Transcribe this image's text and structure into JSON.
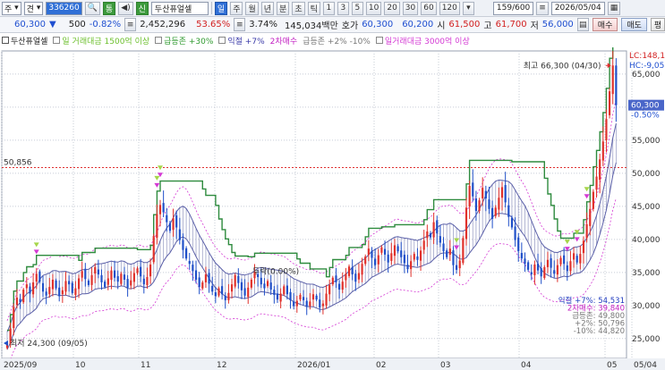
{
  "toolbar": {
    "mode_label": "주",
    "period_label": "견",
    "stock_code": "336260",
    "tag_label": "통",
    "sin_label": "신",
    "stock_name": "두산퓨얼셀",
    "period_selected": "일",
    "periods": [
      "주",
      "월",
      "년",
      "분",
      "초",
      "틱"
    ],
    "intervals": [
      "1",
      "3",
      "5",
      "10",
      "20",
      "30",
      "60",
      "120"
    ],
    "page_counter": "159/600",
    "date": "2026/05/04"
  },
  "quote": {
    "price": "60,300",
    "change_arrow": "▼",
    "change": "500",
    "change_pct": "-0.82%",
    "volume": "2,452,296",
    "ratio": "53.65%",
    "turnover": "3.74%",
    "amount": "145,034백만",
    "ask_label": "호가",
    "ask1": "60,300",
    "ask2": "60,200",
    "open_label": "시",
    "open": "61,500",
    "high_label": "고",
    "high": "61,700",
    "low_label": "저",
    "low": "56,000",
    "buy_label": "매수",
    "sell_label": "매도",
    "eval_label": "평"
  },
  "legend": {
    "stock_name": "두산퓨얼셀",
    "items": [
      {
        "label": "일 거래대금 1500억 이상",
        "color": "#6bbf2b"
      },
      {
        "label": "급등존 +30%",
        "color": "#2f9a2f"
      },
      {
        "label": "익절 +7%",
        "color": "#3a3aa8"
      },
      {
        "label": "2차매수",
        "color": "#c21fc2"
      },
      {
        "label": "급등존 +2% -10%",
        "color": "#777777"
      },
      {
        "label": "일거래대금 3000억 이상",
        "color": "#d43ad4"
      }
    ]
  },
  "chart_labels": {
    "left_marker": "50,856",
    "high_annotation": "최고 66,300 (04/30)",
    "low_annotation": "최저 24,300 (09/05)",
    "mid_annotation": "두락(0.00%)",
    "corner_lc": "LC:148,1",
    "corner_hc": "HC:-9,05",
    "current_price_tag": "60,300",
    "current_pct": "-0.50%",
    "info_rows": [
      {
        "label": "익절 +7%:",
        "value": "54,531",
        "color": "#1f3bbf"
      },
      {
        "label": "2차매수:",
        "value": "39,840",
        "color": "#c21fc2"
      },
      {
        "label": "급등존:",
        "value": "49,800",
        "color": "#777777"
      },
      {
        "label": "+2%:",
        "value": "50,796",
        "color": "#777777"
      },
      {
        "label": "-10%:",
        "value": "44,820",
        "color": "#777777"
      }
    ]
  },
  "colors": {
    "up": "#e0312b",
    "down": "#1f4fc8",
    "green_line": "#2e8b3e",
    "band": "#5a5fa8",
    "magenta": "#d43ad4",
    "grid": "#c7ccd6",
    "ref_line": "#e03030"
  },
  "chart_data": {
    "type": "candlestick",
    "y_ticks": [
      25000,
      30000,
      35000,
      40000,
      45000,
      50000,
      55000,
      60000,
      65000
    ],
    "y_tick_labels": [
      "25,000",
      "30,000",
      "35,000",
      "40,000",
      "45,000",
      "50,000",
      "55,000",
      "60,000",
      "65,000"
    ],
    "ylim": [
      22000,
      68500
    ],
    "x_tick_labels": [
      "2025/09",
      "10",
      "11",
      "12",
      "2026/01",
      "02",
      "03",
      "04",
      "05",
      "05/04"
    ],
    "reference_level": 50856,
    "highest": {
      "value": 66300,
      "date": "04/30"
    },
    "lowest": {
      "value": 24300,
      "date": "09/05"
    },
    "closes": [
      24300,
      26500,
      29800,
      31200,
      30500,
      32400,
      33200,
      31800,
      33500,
      34800,
      33600,
      32100,
      31500,
      32800,
      33900,
      32600,
      31400,
      32300,
      33700,
      33200,
      31900,
      32600,
      34100,
      35200,
      34000,
      33100,
      34600,
      35800,
      34700,
      33500,
      32800,
      34100,
      35300,
      34200,
      33600,
      34800,
      33900,
      32700,
      33800,
      34900,
      35600,
      34400,
      33200,
      34300,
      36200,
      40500,
      43800,
      45200,
      44100,
      42600,
      41300,
      43200,
      41800,
      39900,
      38400,
      37100,
      36300,
      35200,
      33900,
      32800,
      33500,
      34700,
      33300,
      32100,
      31400,
      32600,
      31700,
      30800,
      31900,
      33200,
      34600,
      33400,
      32300,
      31500,
      32700,
      33900,
      35100,
      34300,
      33200,
      32600,
      33700,
      32400,
      31600,
      30900,
      31800,
      32900,
      31700,
      30800,
      29900,
      30700,
      31600,
      30800,
      29800,
      30600,
      31700,
      30900,
      29700,
      30300,
      31800,
      33100,
      34200,
      33500,
      32400,
      33600,
      34800,
      35900,
      34700,
      33600,
      34900,
      36300,
      37400,
      38600,
      37200,
      36100,
      37600,
      38800,
      37700,
      36500,
      37900,
      39100,
      38200,
      37300,
      36400,
      35500,
      36700,
      37800,
      36900,
      38300,
      39800,
      41200,
      40300,
      42600,
      40900,
      39500,
      38200,
      37300,
      38600,
      36100,
      35400,
      36800,
      40200,
      44800,
      48100,
      46500,
      44300,
      45900,
      47800,
      46200,
      44600,
      43100,
      44800,
      46300,
      47900,
      45600,
      43400,
      41800,
      39900,
      38200,
      37100,
      36300,
      35400,
      34700,
      36200,
      35300,
      34400,
      35800,
      36900,
      35700,
      34800,
      36100,
      37200,
      36300,
      35200,
      36700,
      37900,
      36500,
      37800,
      39800,
      42300,
      44600,
      47200,
      49500,
      52100,
      54800,
      58200,
      62400,
      66300,
      60300
    ],
    "series": [
      {
        "name": "급등존 +30%",
        "kind": "step"
      },
      {
        "name": "익절 +7%",
        "kind": "line"
      },
      {
        "name": "-10%",
        "kind": "dashed"
      }
    ]
  }
}
